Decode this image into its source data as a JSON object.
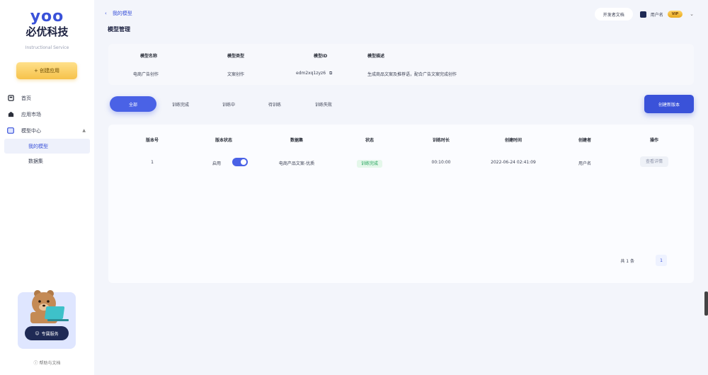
{
  "brand": {
    "logo_en": "yoo",
    "logo_cn": "必优科技",
    "tagline": "Instructional Service"
  },
  "sidebar": {
    "create_button": "+ 创建应用",
    "items": [
      {
        "label": "首页",
        "icon": "dashboard-icon"
      },
      {
        "label": "应用市场",
        "icon": "market-icon"
      },
      {
        "label": "模型中心",
        "icon": "model-icon",
        "expanded": true
      }
    ],
    "sub_items": [
      {
        "label": "我的模型",
        "active": true
      },
      {
        "label": "数据集",
        "active": false
      }
    ],
    "promo_button": "专属服务",
    "help_text": "帮助与文档"
  },
  "header": {
    "breadcrumb": "我的模型",
    "title": "模型管理",
    "docs_link": "开发者文档",
    "username": "用户名",
    "vip_badge": "VIP"
  },
  "info": {
    "columns": [
      {
        "key": "模型名称",
        "value": "电商广告创作"
      },
      {
        "key": "模型类型",
        "value": "文案创作"
      },
      {
        "key": "模型ID",
        "value": "edm2xq1zyz6"
      },
      {
        "key": "模型描述",
        "value": "生成商品文案及推荐语，配合广告文案完成创作"
      }
    ]
  },
  "tabs": {
    "items": [
      {
        "label": "全部",
        "active": true
      },
      {
        "label": "训练完成"
      },
      {
        "label": "训练中"
      },
      {
        "label": "待训练"
      },
      {
        "label": "训练失败"
      }
    ],
    "new_button": "创建新版本"
  },
  "table": {
    "headers": [
      "版本号",
      "版本状态",
      "数据集",
      "状态",
      "训练时长",
      "创建时间",
      "创建者",
      "操作"
    ],
    "rows": [
      {
        "version": "1",
        "version_state": "启用",
        "dataset": "电商产品文案-优质",
        "status": "训练完成",
        "duration": "00:10:00",
        "created": "2022-06-24 02:41:09",
        "creator": "用户名",
        "action": "查看详情"
      }
    ]
  },
  "pagination": {
    "total": "共 1 条",
    "current": "1"
  },
  "colors": {
    "primary": "#3a52d9",
    "accent": "#f6c24a",
    "success": "#22a35a"
  }
}
